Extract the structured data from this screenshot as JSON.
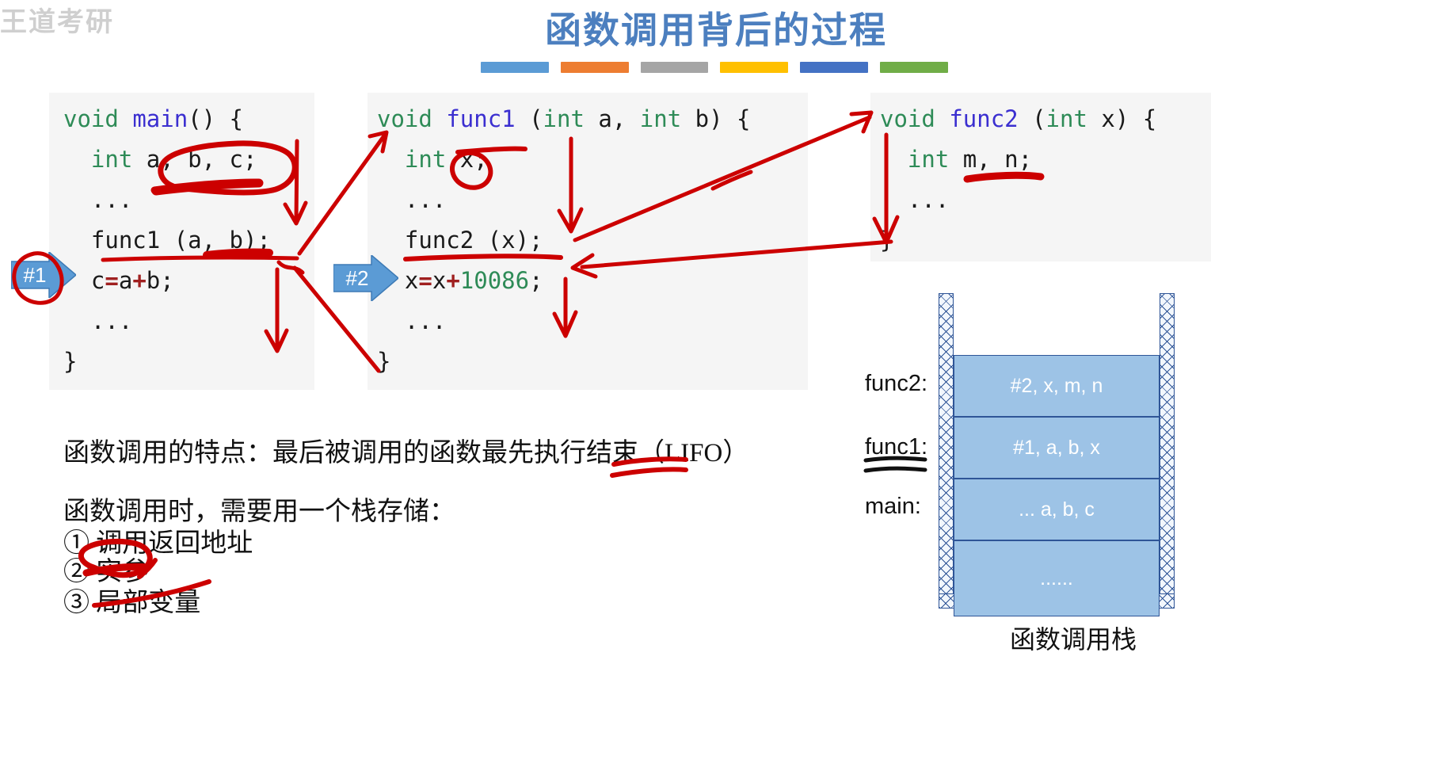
{
  "watermark": "王道考研",
  "slide": {
    "title": "函数调用背后的过程",
    "accent_bars": [
      "#5B9BD5",
      "#ED7D31",
      "#A5A5A5",
      "#FFC000",
      "#4472C4",
      "#70AD47"
    ],
    "title_color": "#4C7FBF"
  },
  "code_blocks": {
    "main": {
      "name": "main-code-block",
      "lines": [
        {
          "parts": [
            {
              "t": "void ",
              "c": "kw"
            },
            {
              "t": "main",
              "c": "fn"
            },
            {
              "t": "() {",
              "c": ""
            }
          ]
        },
        {
          "parts": [
            {
              "t": "  ",
              "c": ""
            },
            {
              "t": "int",
              "c": "kw"
            },
            {
              "t": " a, b, c;",
              "c": ""
            }
          ]
        },
        {
          "parts": [
            {
              "t": "  ...",
              "c": ""
            }
          ]
        },
        {
          "parts": [
            {
              "t": "  func1 (a, b);",
              "c": ""
            }
          ]
        },
        {
          "parts": [
            {
              "t": "  c",
              "c": ""
            },
            {
              "t": "=",
              "c": "op"
            },
            {
              "t": "a",
              "c": ""
            },
            {
              "t": "+",
              "c": "op"
            },
            {
              "t": "b;",
              "c": ""
            }
          ]
        },
        {
          "parts": [
            {
              "t": "  ...",
              "c": ""
            }
          ]
        },
        {
          "parts": [
            {
              "t": "}",
              "c": ""
            }
          ]
        }
      ]
    },
    "func1": {
      "name": "func1-code-block",
      "lines": [
        {
          "parts": [
            {
              "t": "void ",
              "c": "kw"
            },
            {
              "t": "func1",
              "c": "fnu"
            },
            {
              "t": " (",
              "c": ""
            },
            {
              "t": "int",
              "c": "kw"
            },
            {
              "t": " a, ",
              "c": ""
            },
            {
              "t": "int",
              "c": "kw"
            },
            {
              "t": " b) {",
              "c": ""
            }
          ]
        },
        {
          "parts": [
            {
              "t": "  ",
              "c": ""
            },
            {
              "t": "int",
              "c": "kw"
            },
            {
              "t": " x;",
              "c": ""
            }
          ]
        },
        {
          "parts": [
            {
              "t": "  ...",
              "c": ""
            }
          ]
        },
        {
          "parts": [
            {
              "t": "  func2 (x);",
              "c": ""
            }
          ]
        },
        {
          "parts": [
            {
              "t": "  x",
              "c": ""
            },
            {
              "t": "=",
              "c": "op"
            },
            {
              "t": "x",
              "c": ""
            },
            {
              "t": "+",
              "c": "op"
            },
            {
              "t": "10086",
              "c": "num"
            },
            {
              "t": ";",
              "c": ""
            }
          ]
        },
        {
          "parts": [
            {
              "t": "  ...",
              "c": ""
            }
          ]
        },
        {
          "parts": [
            {
              "t": "}",
              "c": ""
            }
          ]
        }
      ]
    },
    "func2": {
      "name": "func2-code-block",
      "lines": [
        {
          "parts": [
            {
              "t": "void ",
              "c": "kw"
            },
            {
              "t": "func2",
              "c": "fn"
            },
            {
              "t": " (",
              "c": ""
            },
            {
              "t": "int",
              "c": "kw"
            },
            {
              "t": " x) {",
              "c": ""
            }
          ]
        },
        {
          "parts": [
            {
              "t": "  ",
              "c": ""
            },
            {
              "t": "int",
              "c": "kw"
            },
            {
              "t": " m, n;",
              "c": ""
            }
          ]
        },
        {
          "parts": [
            {
              "t": "  ...",
              "c": ""
            }
          ]
        },
        {
          "parts": [
            {
              "t": "}",
              "c": ""
            }
          ]
        }
      ]
    }
  },
  "step_markers": [
    {
      "label": "#1",
      "color": "#5B9BD5"
    },
    {
      "label": "#2",
      "color": "#5B9BD5"
    }
  ],
  "notes": {
    "lifo_line": "函数调用的特点：最后被调用的函数最先执行结束（LIFO）",
    "need_line": "函数调用时，需要用一个栈存储：",
    "items": [
      "① 调用返回地址",
      "② 实参",
      "③ 局部变量"
    ]
  },
  "stack": {
    "caption": "函数调用栈",
    "fill_color": "#9DC3E6",
    "border_color": "#2F5597",
    "labels": [
      {
        "text": "func2:",
        "underlined": false
      },
      {
        "text": "func1:",
        "underlined": true
      },
      {
        "text": "main:",
        "underlined": false
      }
    ],
    "frames": [
      {
        "text": "#2, x, m, n"
      },
      {
        "text": "#1, a, b, x"
      },
      {
        "text": "... a, b, c"
      },
      {
        "text": "......"
      }
    ]
  },
  "annotations": {
    "ink_color": "#CC0000",
    "marks": [
      "circle-abc-in-main",
      "underline-abc-in-main",
      "underline-func1-call",
      "underline-args-ab",
      "circle-step1",
      "circle-x-in-func1",
      "underline-func1-decl",
      "underline-func2-call",
      "underline-mn-in-func2",
      "arrow-main-to-func1",
      "arrow-func1-to-func2",
      "arrow-func2-return-to-func1",
      "arrow-func1-return-to-main",
      "underline-lifo",
      "circle-item2",
      "underline-item3",
      "underline-func1-stack-label"
    ]
  }
}
